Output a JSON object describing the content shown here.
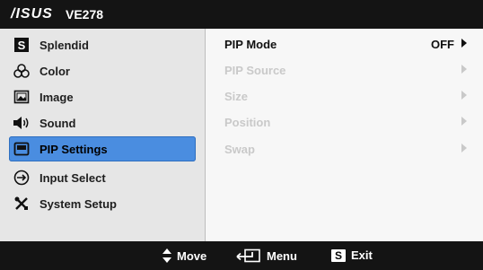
{
  "header": {
    "brand": "/ISUS",
    "model": "VE278"
  },
  "menu": {
    "items": [
      {
        "label": "Splendid",
        "icon": "splendid-s-icon"
      },
      {
        "label": "Color",
        "icon": "color-circles-icon"
      },
      {
        "label": "Image",
        "icon": "image-picture-icon"
      },
      {
        "label": "Sound",
        "icon": "speaker-icon"
      },
      {
        "label": "PIP Settings",
        "icon": "pip-screen-icon",
        "selected": true
      },
      {
        "label": "Input Select",
        "icon": "input-arrow-icon"
      },
      {
        "label": "System Setup",
        "icon": "tools-icon"
      }
    ]
  },
  "options": [
    {
      "label": "PIP Mode",
      "value": "OFF",
      "enabled": true
    },
    {
      "label": "PIP Source",
      "value": "",
      "enabled": false
    },
    {
      "label": "Size",
      "value": "",
      "enabled": false
    },
    {
      "label": "Position",
      "value": "",
      "enabled": false
    },
    {
      "label": "Swap",
      "value": "",
      "enabled": false
    }
  ],
  "footer": {
    "move_label": "Move",
    "menu_label": "Menu",
    "exit_label": "Exit",
    "exit_key": "S"
  },
  "colors": {
    "selected_bg": "#4a8de0",
    "bar_bg": "#141414",
    "disabled_text": "#c9c9c9"
  }
}
